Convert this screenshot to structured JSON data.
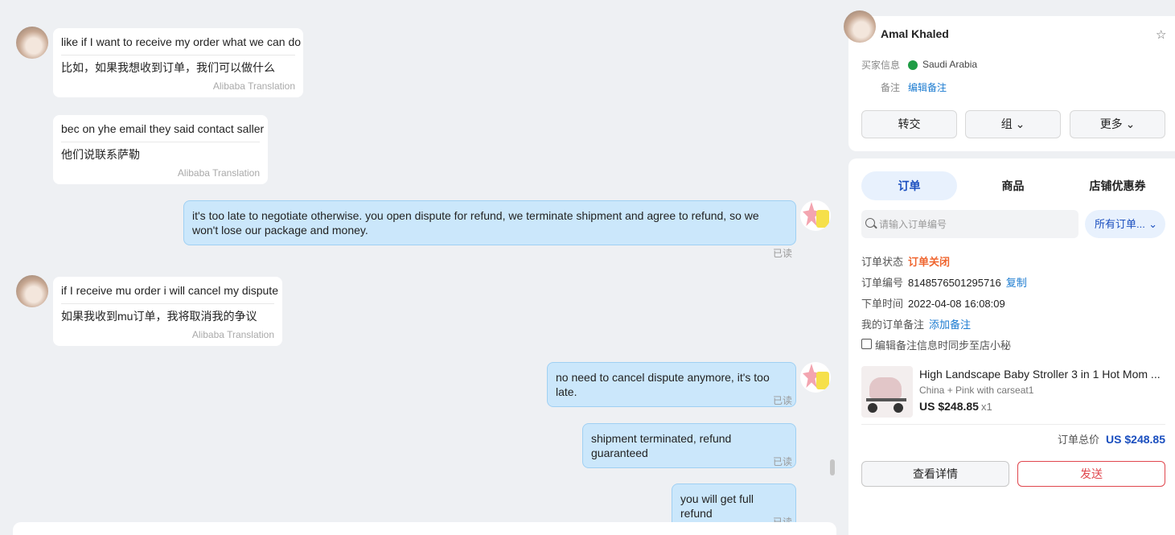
{
  "messages": [
    {
      "direction": "in",
      "original": "like if I want to receive my order what we can do",
      "translation": "比如，如果我想收到订单，我们可以做什么",
      "source": "Alibaba Translation"
    },
    {
      "direction": "in",
      "original": "bec on yhe email they said contact saller",
      "translation": "他们说联系萨勒",
      "source": "Alibaba Translation"
    },
    {
      "direction": "out",
      "text": "it's too late to negotiate otherwise. you open dispute for refund, we terminate shipment and agree to refund, so we won't lose our package and money.",
      "status": "已读"
    },
    {
      "direction": "in",
      "original": "if I receive mu order i will cancel my dispute",
      "translation": "如果我收到mu订单，我将取消我的争议",
      "source": "Alibaba Translation"
    },
    {
      "direction": "out",
      "text": "no need to cancel dispute anymore, it's too late.",
      "status": "已读"
    },
    {
      "direction": "out",
      "text": "shipment terminated, refund guaranteed",
      "status": "已读"
    },
    {
      "direction": "out",
      "text": "you will get full refund",
      "status": "已读"
    }
  ],
  "profile": {
    "name": "Amal Khaled",
    "buyer_info_label": "买家信息",
    "country": "Saudi Arabia",
    "note_label": "备注",
    "edit_note": "编辑备注",
    "buttons": [
      "转交",
      "组",
      "更多"
    ]
  },
  "order_panel": {
    "tabs": [
      "订单",
      "商品",
      "店铺优惠券"
    ],
    "active_tab": "订单",
    "search_placeholder": "请输入订单编号",
    "filter_label": "所有订单...",
    "status_label": "订单状态",
    "status_value": "订单关闭",
    "order_no_label": "订单编号",
    "order_no": "8148576501295716",
    "copy_label": "复制",
    "time_label": "下单时间",
    "time_value": "2022-04-08 16:08:09",
    "my_note_label": "我的订单备注",
    "add_note": "添加备注",
    "sync_label": "编辑备注信息时同步至店小秘",
    "product": {
      "title": "High Landscape Baby Stroller 3 in 1 Hot Mom ...",
      "variant": "China + Pink with carseat1",
      "price": "US $248.85",
      "qty": "x1"
    },
    "total_label": "订单总价",
    "total_value": "US $248.85",
    "detail_button": "查看详情",
    "send_button": "发送"
  },
  "colors": {
    "accent": "#1b4fbf",
    "status_closed": "#ef6630",
    "send": "#e0464d",
    "bubble_out": "#cbe7fb"
  }
}
